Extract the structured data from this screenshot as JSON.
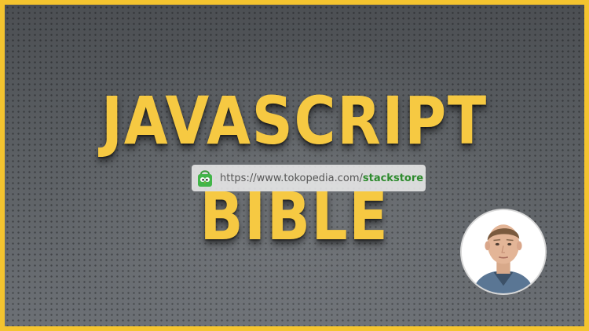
{
  "title": {
    "line1": "JAVASCRIPT",
    "line2": "BIBLE"
  },
  "watermark": {
    "icon": "shopping-bag-icon",
    "url_prefix": "https://www.tokopedia.com/",
    "url_store": "stackstore"
  },
  "colors": {
    "border": "#f4c42f",
    "title": "#f6c942",
    "store_link": "#2e8b2e"
  },
  "avatar": {
    "icon": "instructor-photo"
  }
}
